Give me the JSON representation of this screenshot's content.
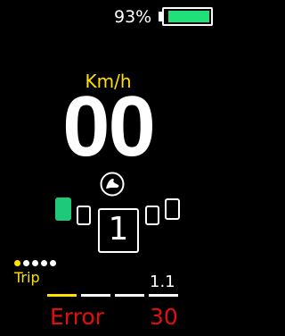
{
  "battery": {
    "percent_text": "93%",
    "level": 0.93,
    "color": "#20e07a"
  },
  "speed": {
    "unit": "Km/h",
    "value": "00"
  },
  "walk_assist": {
    "icon": "walk-assist-icon"
  },
  "assist": {
    "level": "1",
    "active_color": "#1ec97a"
  },
  "trip": {
    "label": "Trip",
    "value": "1.1",
    "page_dots": 5,
    "active_dot": 0,
    "accent": "#ffe000"
  },
  "error": {
    "label": "Error",
    "code": "30",
    "color": "#e01010"
  }
}
